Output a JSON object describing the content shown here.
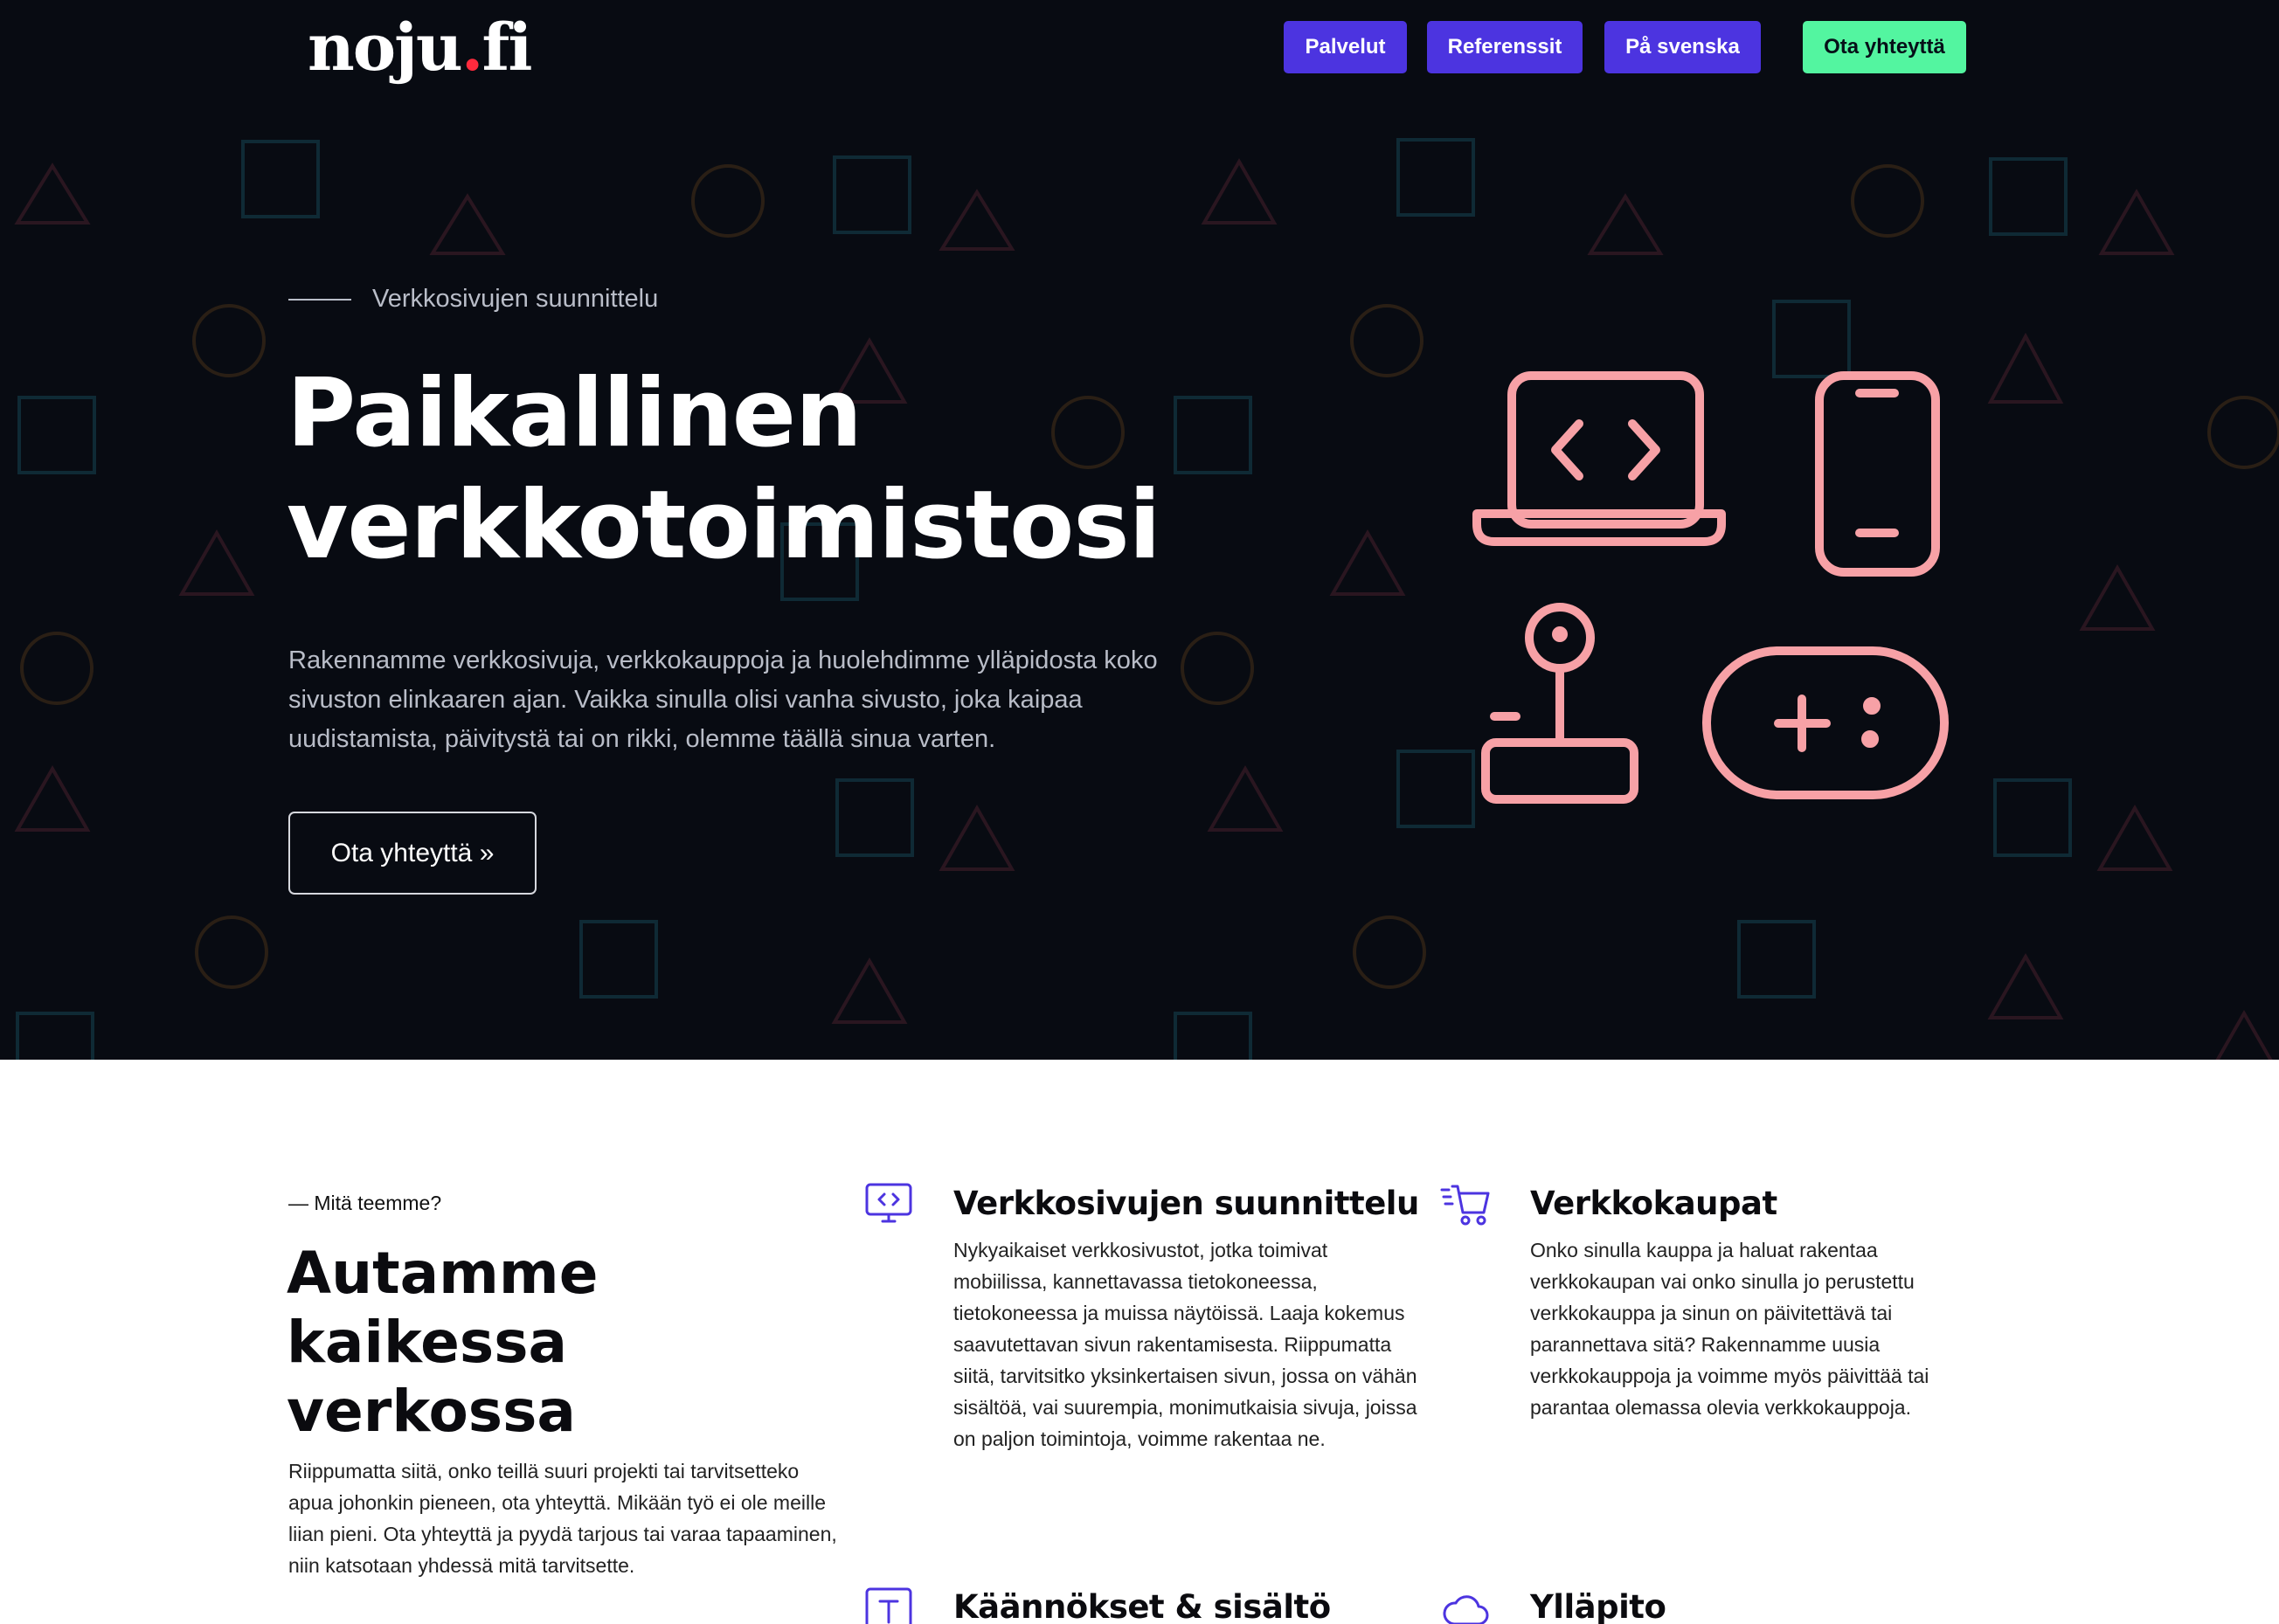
{
  "header": {
    "logo_text": "noju",
    "logo_dot": ".",
    "logo_tld": "fi",
    "nav": [
      {
        "label": "Palvelut"
      },
      {
        "label": "Referenssit"
      },
      {
        "label": "På svenska"
      }
    ],
    "contact_label": "Ota yhteyttä"
  },
  "hero": {
    "eyebrow": "Verkkosivujen suunnittelu",
    "title_line1": "Paikallinen",
    "title_line2": "verkkotoimistosi",
    "description": "Rakennamme verkkosivuja, verkkokauppoja ja huolehdimme ylläpidosta koko sivuston elinkaaren ajan. Vaikka sinulla olisi vanha sivusto, joka kaipaa uudistamista, päivitystä tai on rikki, olemme täällä sinua varten.",
    "cta_label": "Ota yhteyttä »",
    "icons": [
      "laptop-code-icon",
      "smartphone-icon",
      "joystick-icon",
      "gamepad-icon"
    ],
    "accent_color": "#f7a1a6"
  },
  "services": {
    "kicker": "— Mitä teemme?",
    "title_line1": "Autamme",
    "title_line2": "kaikessa",
    "title_line3": "verkossa",
    "intro": "Riippumatta siitä, onko teillä suuri projekti tai tarvitsetteko apua johonkin pieneen, ota yhteyttä. Mikään työ ei ole meille liian pieni. Ota yhteyttä ja pyydä tarjous tai varaa tapaaminen, niin katsotaan yhdessä mitä tarvitsette.",
    "items": [
      {
        "icon": "monitor-code-icon",
        "title": "Verkkosivujen suunnittelu",
        "text": "Nykyaikaiset verkkosivustot, jotka toimivat mobiilissa, kannettavassa tietokoneessa, tietokoneessa ja muissa näytöissä. Laaja kokemus saavutettavan sivun rakentamisesta. Riippumatta siitä, tarvitsitko yksinkertaisen sivun, jossa on vähän sisältöä, vai suurempia, monimutkaisia sivuja, joissa on paljon toimintoja, voimme rakentaa ne."
      },
      {
        "icon": "shopping-cart-icon",
        "title": "Verkkokaupat",
        "text": "Onko sinulla kauppa ja haluat rakentaa verkkokaupan vai onko sinulla jo perustettu verkkokauppa ja sinun on päivitettävä tai parannettava sitä? Rakennamme uusia verkkokauppoja ja voimme myös päivittää tai parantaa olemassa olevia verkkokauppoja."
      },
      {
        "icon": "text-icon",
        "title": "Käännökset & sisältö",
        "text": ""
      },
      {
        "icon": "cloud-icon",
        "title": "Ylläpito",
        "text": ""
      }
    ],
    "icon_color": "#4c34e0"
  }
}
